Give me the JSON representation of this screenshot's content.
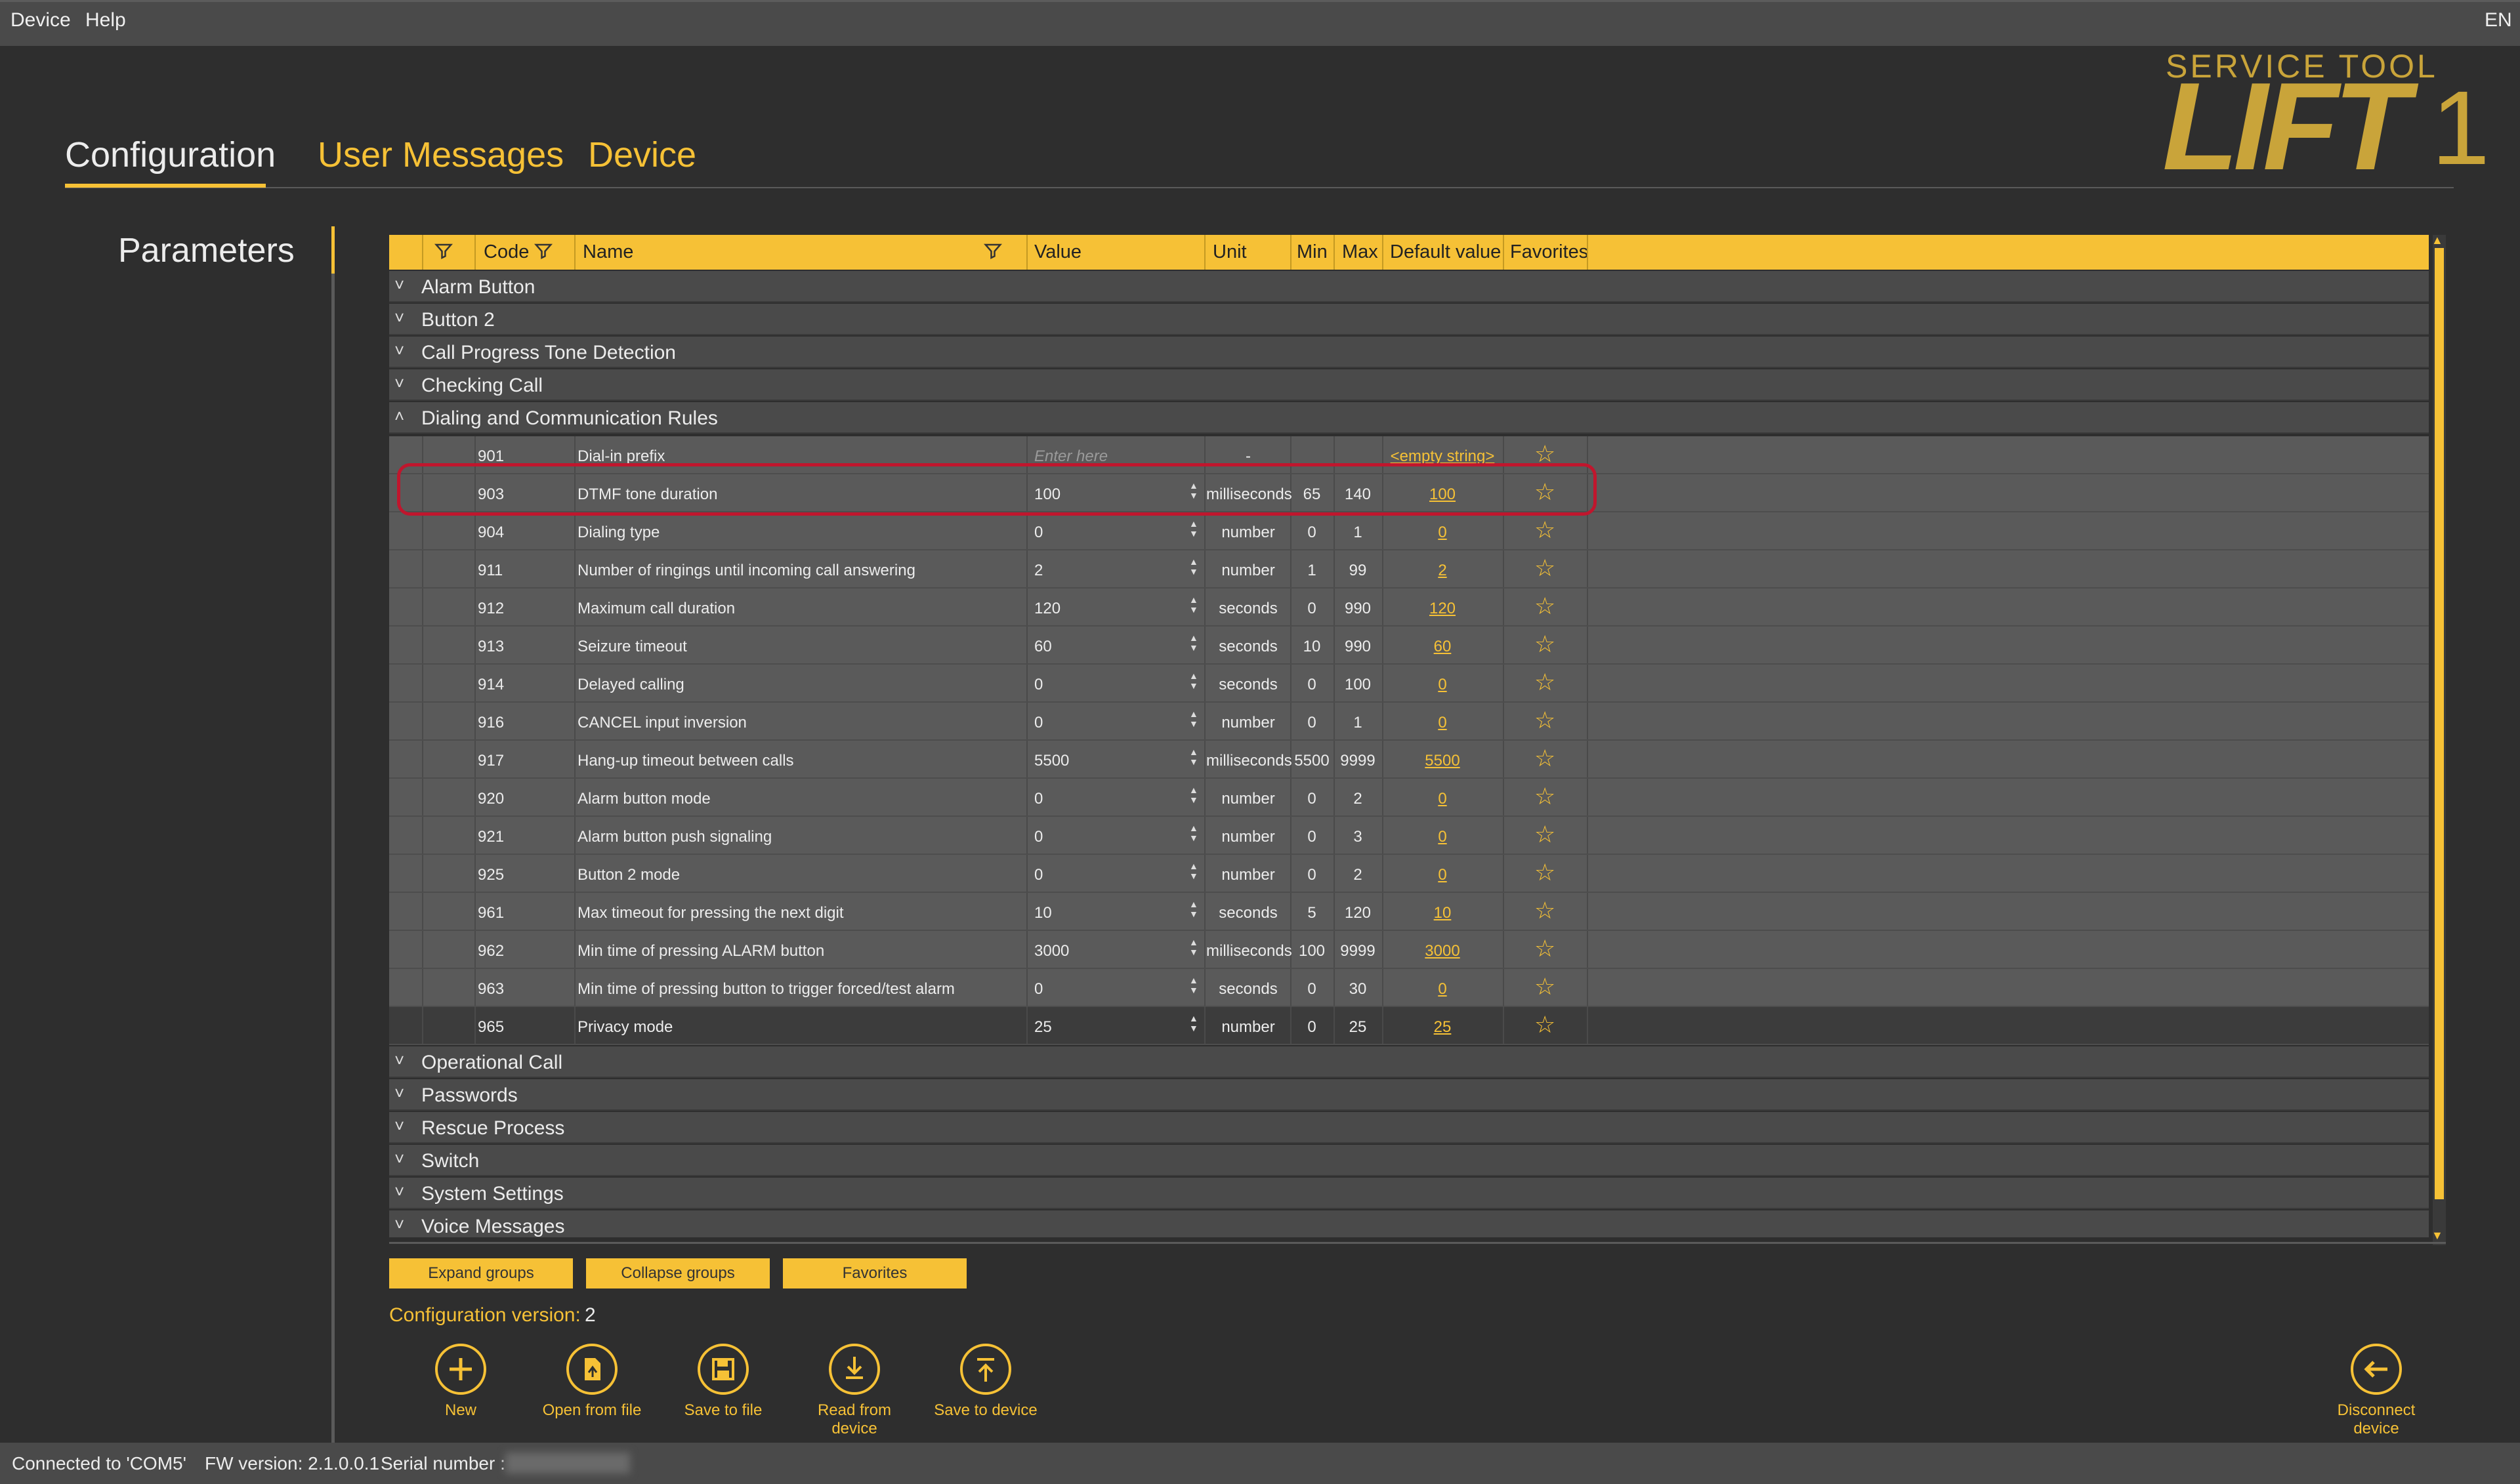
{
  "menu": {
    "device": "Device",
    "help": "Help",
    "language": "EN"
  },
  "tabs": {
    "configuration": "Configuration",
    "user_messages": "User Messages",
    "device": "Device"
  },
  "logo": {
    "top": "SERVICE TOOL",
    "main": "LIFT",
    "suffix": "1"
  },
  "sidebar": {
    "title": "Parameters"
  },
  "table": {
    "headers": {
      "code": "Code",
      "name": "Name",
      "value": "Value",
      "unit": "Unit",
      "min": "Min",
      "max": "Max",
      "default": "Default value",
      "favorites": "Favorites"
    },
    "groups_top": [
      {
        "label": "Alarm Button",
        "chevron": "˅"
      },
      {
        "label": "Button 2",
        "chevron": "˅"
      },
      {
        "label": "Call Progress Tone Detection",
        "chevron": "˅"
      },
      {
        "label": "Checking Call",
        "chevron": "˅"
      },
      {
        "label": "Dialing and Communication Rules",
        "chevron": "˄"
      }
    ],
    "rows": [
      {
        "code": "901",
        "name": "Dial-in prefix",
        "value": "",
        "placeholder": "Enter here",
        "unit": "-",
        "min": "",
        "max": "",
        "default": "<empty string>",
        "spinner": false
      },
      {
        "code": "903",
        "name": "DTMF tone duration",
        "value": "100",
        "unit": "milliseconds",
        "min": "65",
        "max": "140",
        "default": "100",
        "spinner": true
      },
      {
        "code": "904",
        "name": "Dialing type",
        "value": "0",
        "unit": "number",
        "min": "0",
        "max": "1",
        "default": "0",
        "spinner": true
      },
      {
        "code": "911",
        "name": "Number of ringings until incoming call answering",
        "value": "2",
        "unit": "number",
        "min": "1",
        "max": "99",
        "default": "2",
        "spinner": true
      },
      {
        "code": "912",
        "name": "Maximum call duration",
        "value": "120",
        "unit": "seconds",
        "min": "0",
        "max": "990",
        "default": "120",
        "spinner": true
      },
      {
        "code": "913",
        "name": "Seizure timeout",
        "value": "60",
        "unit": "seconds",
        "min": "10",
        "max": "990",
        "default": "60",
        "spinner": true
      },
      {
        "code": "914",
        "name": "Delayed calling",
        "value": "0",
        "unit": "seconds",
        "min": "0",
        "max": "100",
        "default": "0",
        "spinner": true
      },
      {
        "code": "916",
        "name": "CANCEL input inversion",
        "value": "0",
        "unit": "number",
        "min": "0",
        "max": "1",
        "default": "0",
        "spinner": true
      },
      {
        "code": "917",
        "name": "Hang-up timeout between calls",
        "value": "5500",
        "unit": "milliseconds",
        "min": "5500",
        "max": "9999",
        "default": "5500",
        "spinner": true
      },
      {
        "code": "920",
        "name": "Alarm button mode",
        "value": "0",
        "unit": "number",
        "min": "0",
        "max": "2",
        "default": "0",
        "spinner": true
      },
      {
        "code": "921",
        "name": "Alarm button push signaling",
        "value": "0",
        "unit": "number",
        "min": "0",
        "max": "3",
        "default": "0",
        "spinner": true
      },
      {
        "code": "925",
        "name": "Button 2 mode",
        "value": "0",
        "unit": "number",
        "min": "0",
        "max": "2",
        "default": "0",
        "spinner": true
      },
      {
        "code": "961",
        "name": "Max timeout for pressing the next digit",
        "value": "10",
        "unit": "seconds",
        "min": "5",
        "max": "120",
        "default": "10",
        "spinner": true
      },
      {
        "code": "962",
        "name": "Min time of pressing ALARM button",
        "value": "3000",
        "unit": "milliseconds",
        "min": "100",
        "max": "9999",
        "default": "3000",
        "spinner": true
      },
      {
        "code": "963",
        "name": "Min time of pressing button to trigger forced/test alarm",
        "value": "0",
        "unit": "seconds",
        "min": "0",
        "max": "30",
        "default": "0",
        "spinner": true
      },
      {
        "code": "965",
        "name": "Privacy mode",
        "value": "25",
        "unit": "number",
        "min": "0",
        "max": "25",
        "default": "25",
        "spinner": true
      }
    ],
    "groups_bottom": [
      {
        "label": "Operational Call",
        "chevron": "˅"
      },
      {
        "label": "Passwords",
        "chevron": "˅"
      },
      {
        "label": "Rescue Process",
        "chevron": "˅"
      },
      {
        "label": "Switch",
        "chevron": "˅"
      },
      {
        "label": "System Settings",
        "chevron": "˅"
      },
      {
        "label": "Voice Messages",
        "chevron": "˅"
      }
    ]
  },
  "group_buttons": {
    "expand": "Expand groups",
    "collapse": "Collapse groups",
    "favorites": "Favorites"
  },
  "config_version": {
    "label": "Configuration version:",
    "value": "2"
  },
  "actions": {
    "new": "New",
    "open": "Open from file",
    "save_file": "Save to file",
    "read_line1": "Read from",
    "read_line2": "device",
    "save_device": "Save to device",
    "disconnect_line1": "Disconnect",
    "disconnect_line2": "device"
  },
  "status": {
    "connection": "Connected to 'COM5'",
    "fw": "FW version: 2.1.0.0.1",
    "serial_label": "Serial number :"
  },
  "colors": {
    "accent": "#f6c136",
    "background": "#2e2e2e",
    "row": "#5a5a5a",
    "highlight": "#c0162d"
  }
}
